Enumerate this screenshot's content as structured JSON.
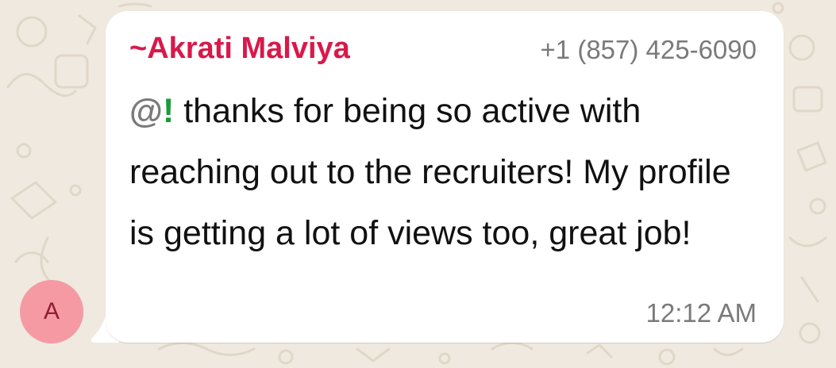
{
  "chat": {
    "avatar_initial": "A",
    "message": {
      "sender_prefix": "~",
      "sender_name": "Akrati Malviya",
      "sender_phone": "+1 (857) 425-6090",
      "mention_symbol": "@",
      "mention_name": "!",
      "text": " thanks for being so active with reaching out to the recruiters! My profile is getting a lot of views too, great job!",
      "time": "12:12 AM"
    }
  },
  "colors": {
    "background": "#efe9df",
    "bubble": "#ffffff",
    "sender_name": "#d8194a",
    "mention": "#1a9b3a",
    "avatar_bg": "#f59aa3",
    "meta_text": "#7a7a7a"
  }
}
